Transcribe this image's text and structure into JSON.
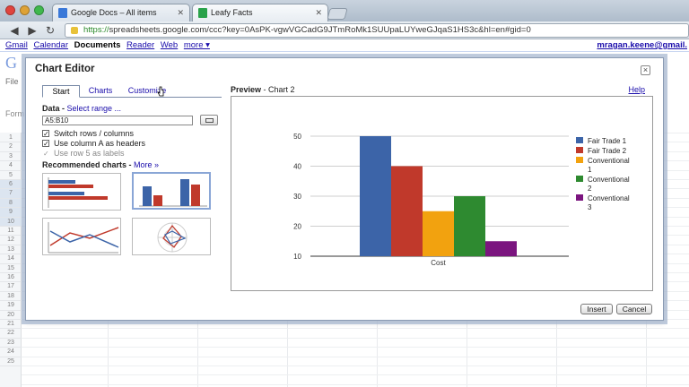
{
  "browser": {
    "tabs": [
      {
        "label": "Google Docs – All items"
      },
      {
        "label": "Leafy Facts"
      }
    ],
    "url_scheme": "https://",
    "url_rest": "spreadsheets.google.com/ccc?key=0AsPK-vgwVGCadG9JTmRoMk1SUUpaLUYweGJqaS1HS3c&hl=en#gid=0"
  },
  "google_bar": {
    "links": [
      "Gmail",
      "Calendar",
      "Documents",
      "Reader",
      "Web",
      "more ▾"
    ],
    "current": "Documents",
    "user": "mragan.keene@gmail."
  },
  "background": {
    "logo": "G",
    "file_menu": "File",
    "formula": "Form",
    "row_numbers": [
      "1",
      "2",
      "3",
      "4",
      "5",
      "6",
      "7",
      "8",
      "9",
      "10",
      "11",
      "12",
      "13",
      "14",
      "15",
      "16",
      "17",
      "18",
      "19",
      "20",
      "21",
      "22",
      "23",
      "24",
      "25"
    ]
  },
  "dialog": {
    "title": "Chart Editor",
    "close": "×",
    "tabs": [
      {
        "label": "Start",
        "active": true
      },
      {
        "label": "Charts",
        "active": false
      },
      {
        "label": "Customize",
        "active": false
      }
    ],
    "data_label": "Data",
    "select_range": "Select range ...",
    "range_value": "A5:B10",
    "checks": [
      {
        "label": "Switch rows / columns",
        "checked": true,
        "disabled": false
      },
      {
        "label": "Use column A as headers",
        "checked": true,
        "disabled": false
      },
      {
        "label": "Use row 5 as labels",
        "checked": true,
        "disabled": true
      }
    ],
    "recommended_label": "Recommended charts",
    "more_link": "More »",
    "preview_label": "Preview",
    "preview_name": "- Chart 2",
    "help": "Help",
    "insert": "Insert",
    "cancel": "Cancel"
  },
  "chart_data": {
    "type": "bar",
    "categories": [
      "Cost"
    ],
    "series": [
      {
        "name": "Fair Trade 1",
        "values": [
          50
        ],
        "color": "#3c64a8"
      },
      {
        "name": "Fair Trade 2",
        "values": [
          40
        ],
        "color": "#c0392b"
      },
      {
        "name": "Conventional 1",
        "values": [
          25
        ],
        "color": "#f2a20f"
      },
      {
        "name": "Conventional 2",
        "values": [
          30
        ],
        "color": "#2e8a30"
      },
      {
        "name": "Conventional 3",
        "values": [
          15
        ],
        "color": "#7b157f"
      }
    ],
    "legend_lines": [
      [
        "Fair Trade 1"
      ],
      [
        "Fair Trade 2"
      ],
      [
        "Conventional",
        "1"
      ],
      [
        "Conventional",
        "2"
      ],
      [
        "Conventional",
        "3"
      ]
    ],
    "yticks": [
      10,
      20,
      30,
      40,
      50
    ],
    "ylim": [
      10,
      50
    ],
    "legend": "right",
    "grid": true
  }
}
